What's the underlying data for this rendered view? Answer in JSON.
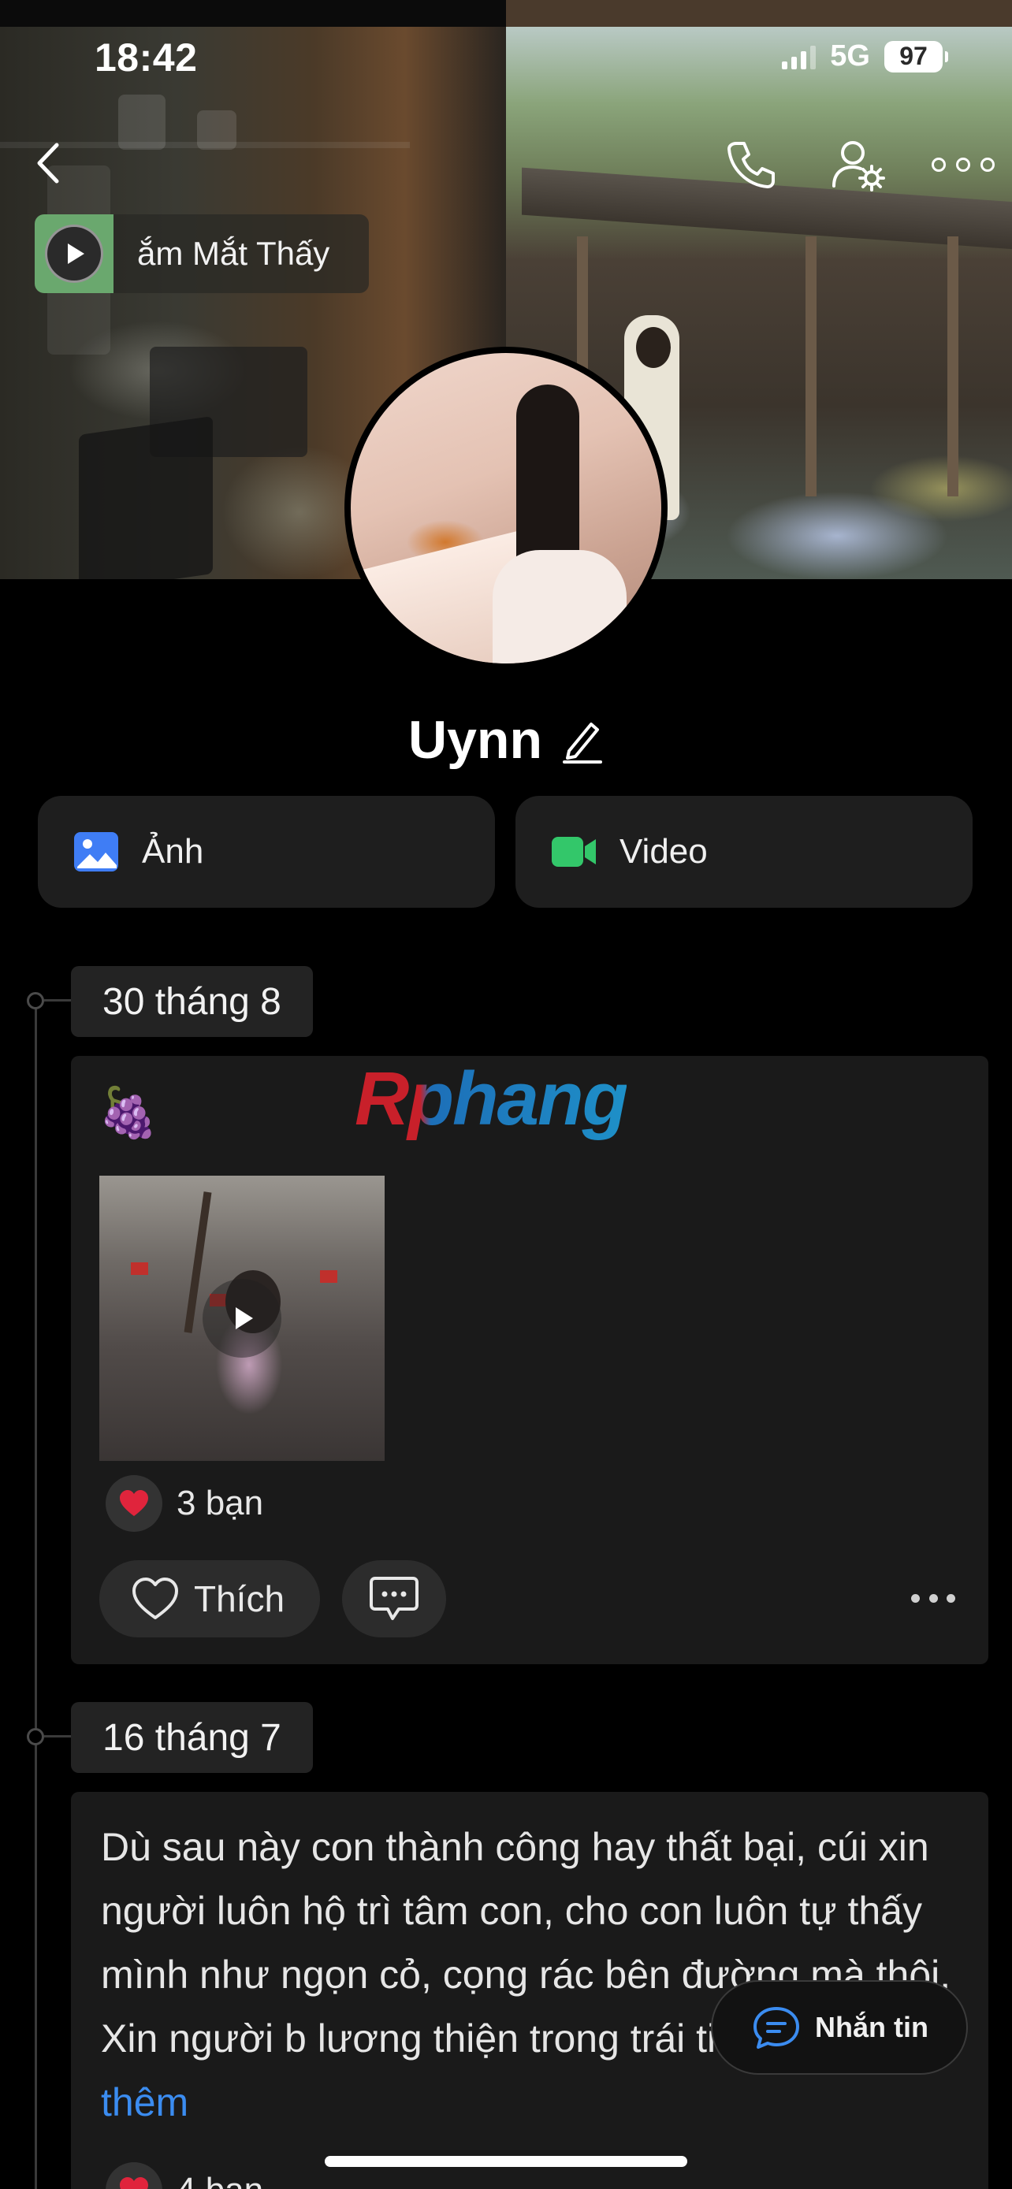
{
  "status_bar": {
    "time": "18:42",
    "network": "5G",
    "battery": "97"
  },
  "header": {
    "back_icon": "chevron-left-icon",
    "call_icon": "phone-icon",
    "settings_icon": "user-settings-icon",
    "more_icon": "ellipsis-icon"
  },
  "music": {
    "title": "ắm Mắt Thấy",
    "icon": "play-icon"
  },
  "profile": {
    "name": "Uynn",
    "edit_icon": "pencil-icon"
  },
  "media_buttons": [
    {
      "label": "Ảnh",
      "icon": "image-icon",
      "color": "#3f7df5"
    },
    {
      "label": "Video",
      "icon": "video-camera-icon",
      "color": "#33c76a"
    }
  ],
  "watermark": "Rphang",
  "posts": [
    {
      "date": "30 tháng 8",
      "emoji": "🍇",
      "has_video": true,
      "reactions": "3 bạn",
      "like_label": "Thích"
    },
    {
      "date": "16 tháng 7",
      "text": "Dù sau này con thành công hay thất bại, cúi xin người luôn hộ trì tâm con, cho con luôn tự thấy mình như ngọn cỏ, cọng rác bên đường mà thôi. Xin người b lương thiện trong trái tim con ...",
      "see_more": "Xem thêm",
      "reactions": "4 bạn"
    }
  ],
  "message_button": {
    "label": "Nhắn tin",
    "icon": "chat-bubble-icon",
    "color": "#3b8cf0"
  },
  "colors": {
    "accent_blue": "#3b8cf0",
    "card_bg": "#1a1a1a",
    "heart": "#e0243c"
  }
}
